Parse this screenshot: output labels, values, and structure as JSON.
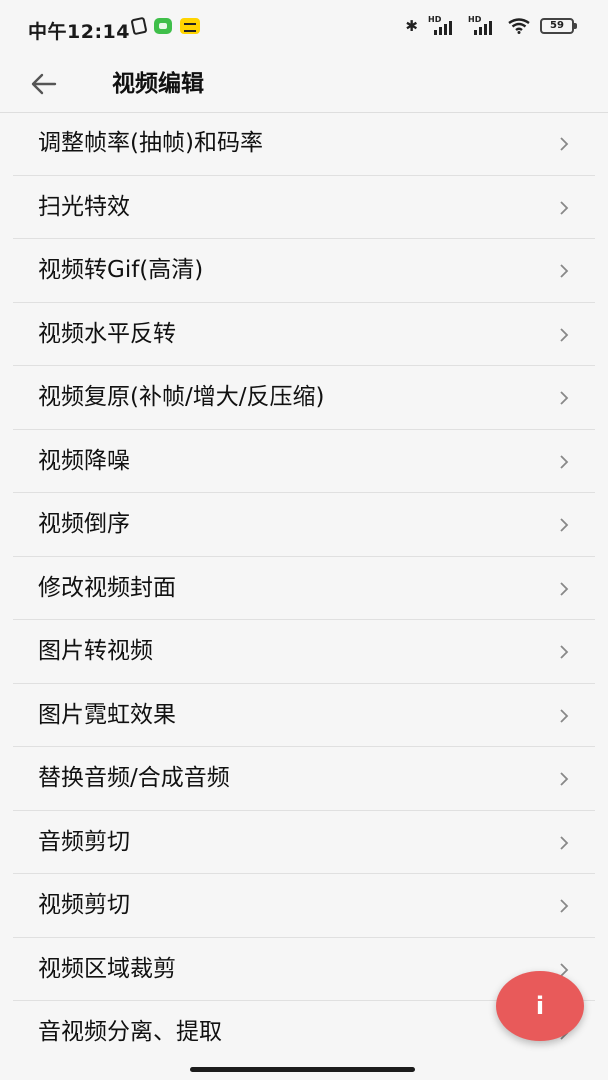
{
  "status_bar": {
    "time": "中午12:14",
    "left_icons": [
      "phone-rotate-icon",
      "message-icon",
      "app-notification-icon"
    ],
    "signal_badge_1": "HD",
    "signal_badge_2": "HD",
    "battery": "59"
  },
  "header": {
    "title": "视频编辑",
    "back_icon": "arrow-left-icon"
  },
  "menu": {
    "items": [
      {
        "label": "调整帧率(抽帧)和码率"
      },
      {
        "label": "扫光特效"
      },
      {
        "label": "视频转Gif(高清)"
      },
      {
        "label": "视频水平反转"
      },
      {
        "label": "视频复原(补帧/增大/反压缩)"
      },
      {
        "label": "视频降噪"
      },
      {
        "label": "视频倒序"
      },
      {
        "label": "修改视频封面"
      },
      {
        "label": "图片转视频"
      },
      {
        "label": "图片霓虹效果"
      },
      {
        "label": "替换音频/合成音频"
      },
      {
        "label": "音频剪切"
      },
      {
        "label": "视频剪切"
      },
      {
        "label": "视频区域裁剪"
      },
      {
        "label": "音视频分离、提取"
      }
    ],
    "chevron_icon": "chevron-right-icon"
  },
  "fab": {
    "label": "i",
    "color": "#e85a5a"
  }
}
